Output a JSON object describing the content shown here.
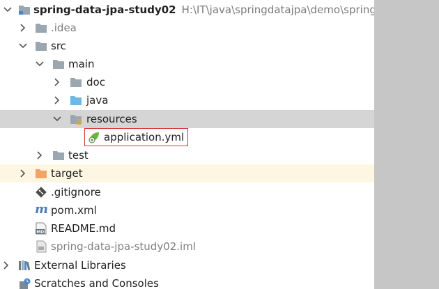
{
  "tree": {
    "project": {
      "name": "spring-data-jpa-study02",
      "path": "H:\\IT\\java\\springdatajpa\\demo\\spring-da"
    },
    "idea": ".idea",
    "src": "src",
    "main": "main",
    "doc": "doc",
    "java": "java",
    "resources": "resources",
    "application_yml": "application.yml",
    "test": "test",
    "target": "target",
    "gitignore": ".gitignore",
    "pom": "pom.xml",
    "readme": "README.md",
    "iml": "spring-data-jpa-study02.iml",
    "external_libraries": "External Libraries",
    "scratches": "Scratches and Consoles"
  },
  "colors": {
    "folder": "#9aa7b0",
    "source_folder": "#6cb8e6",
    "excluded_folder": "#f2a466",
    "highlight_border": "#d03a3a",
    "selection": "#d5d5d5"
  },
  "icons": {
    "project": "folder-icon",
    "yml": "spring-leaf-icon",
    "gitignore": "git-icon",
    "pom": "maven-icon",
    "readme": "markdown-icon",
    "iml": "module-file-icon",
    "libraries": "library-icon",
    "scratches": "scratches-icon"
  }
}
